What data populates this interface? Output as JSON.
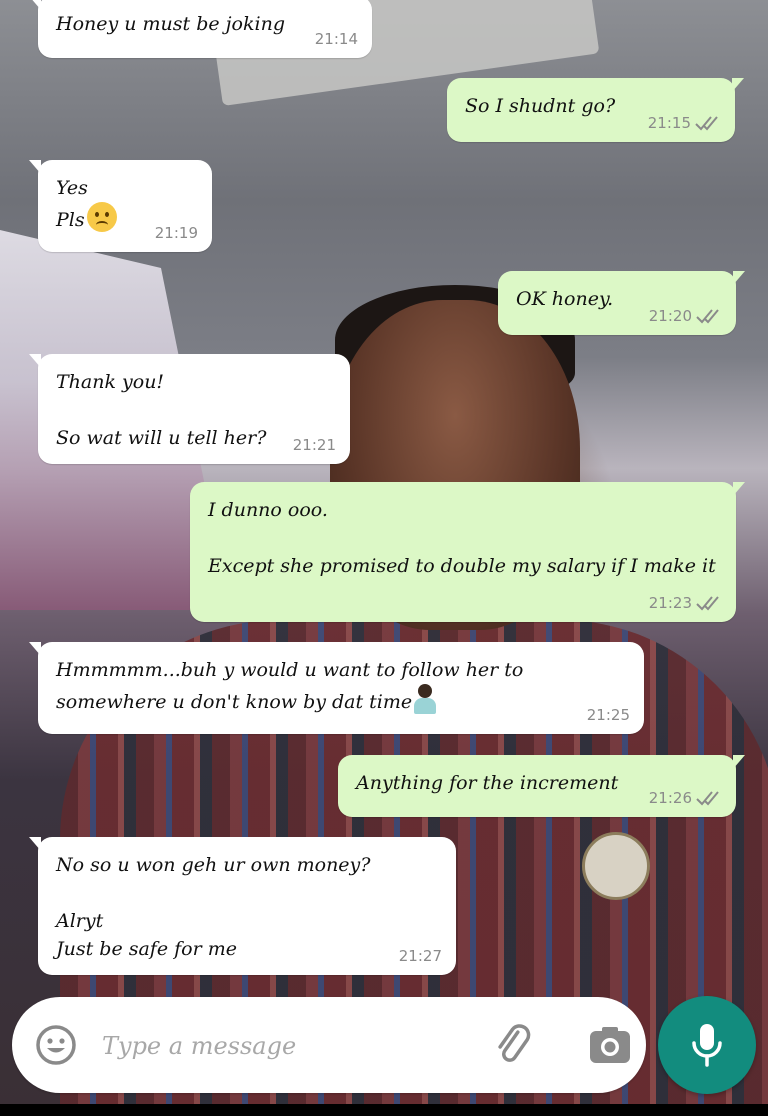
{
  "messages": [
    {
      "text": "Honey u must be joking",
      "time": "21:14",
      "dir": "in"
    },
    {
      "text": "So I shudnt go?",
      "time": "21:15",
      "dir": "out"
    },
    {
      "line1": "Yes",
      "line2": "Pls",
      "time": "21:19",
      "dir": "in",
      "emoji": "frowning-face"
    },
    {
      "text": "OK honey.",
      "time": "21:20",
      "dir": "out"
    },
    {
      "text": "Thank you!\n\nSo wat will u tell her?",
      "time": "21:21",
      "dir": "in"
    },
    {
      "text": "I dunno ooo.\n\nExcept she promised to double my salary if I make it",
      "time": "21:23",
      "dir": "out"
    },
    {
      "text": "Hmmmmm...buh y would u want to follow her to somewhere u don't know by dat time",
      "time": "21:25",
      "dir": "in",
      "emoji": "person-shrugging"
    },
    {
      "text": "Anything for the increment",
      "time": "21:26",
      "dir": "out"
    },
    {
      "text": "No so u won geh ur own money?\n\nAlryt\nJust be safe for me",
      "time": "21:27",
      "dir": "in"
    }
  ],
  "composer": {
    "placeholder": "Type a message",
    "emoji_icon": "smiley-icon",
    "attach_icon": "paperclip-icon",
    "camera_icon": "camera-icon",
    "mic_icon": "microphone-icon"
  },
  "colors": {
    "incoming_bubble": "#ffffff",
    "outgoing_bubble": "#dcf8c6",
    "mic_button": "#128c7e",
    "timestamp": "#8a8a8a"
  }
}
